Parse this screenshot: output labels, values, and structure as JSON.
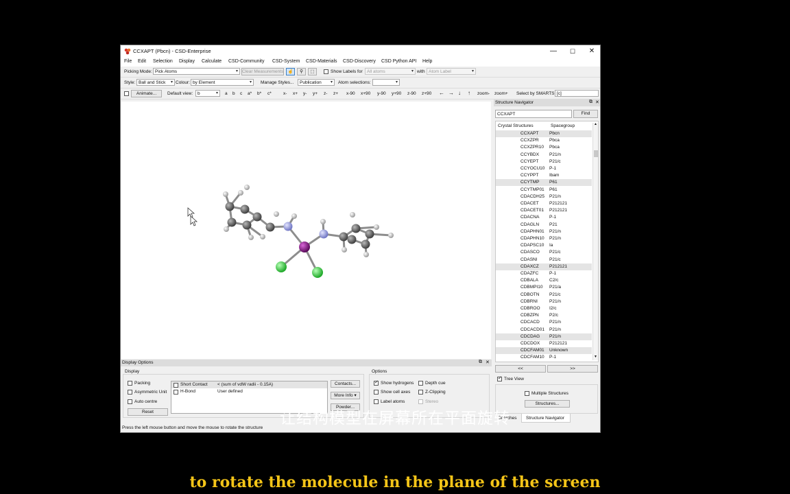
{
  "window": {
    "title": "CCXAPT (Pbcn) - CSD-Enterprise",
    "minimize": "—",
    "maximize": "☐",
    "close": "✕"
  },
  "menu": [
    "File",
    "Edit",
    "Selection",
    "Display",
    "Calculate",
    "CSD-Community",
    "CSD-System",
    "CSD-Materials",
    "CSD-Discovery",
    "CSD Python API",
    "Help"
  ],
  "toolbar1": {
    "picking_mode_label": "Picking Mode:",
    "picking_mode_value": "Pick Atoms",
    "clear_measurements": "Clear Measurements",
    "show_labels_for": "Show Labels for",
    "labels_value": "All atoms",
    "with_label": "with",
    "atom_label_value": "Atom Label"
  },
  "toolbar2": {
    "style_label": "Style:",
    "style_value": "Ball and Stick",
    "colour_label": "Colour:",
    "colour_value": "by Element",
    "manage_styles": "Manage Styles...",
    "manage_value": "Publication",
    "atom_selections_label": "Atom selections:",
    "atom_selections_value": ""
  },
  "toolbar3": {
    "animate": "Animate...",
    "default_view_label": "Default view:",
    "default_view_value": "b",
    "axes": [
      "a",
      "b",
      "c",
      "a*",
      "b*",
      "c*"
    ],
    "rot": [
      "x-",
      "x+",
      "y-",
      "y+",
      "z-",
      "z+",
      "x-90",
      "x+90",
      "y-90",
      "y+90",
      "z-90",
      "z+90"
    ],
    "arrows": [
      "←",
      "→",
      "↓",
      "↑"
    ],
    "zoom": [
      "zoom-",
      "zoom+"
    ],
    "smarts_label": "Select by SMARTS:",
    "smarts_value": "[c]"
  },
  "navigator": {
    "title": "Structure Navigator",
    "search_value": "CCXAPT",
    "find": "Find",
    "col1": "Crystal Structures",
    "col2": "Spacegroup",
    "rows": [
      [
        "CCXAPT",
        "Pbcn"
      ],
      [
        "CCXZPR",
        "Pbca"
      ],
      [
        "CCXZPR10",
        "Pbca"
      ],
      [
        "CCYBDX",
        "P21/n"
      ],
      [
        "CCYEPT",
        "P21/c"
      ],
      [
        "CCYOCU10",
        "P-1"
      ],
      [
        "CCYPPT",
        "Ibam"
      ],
      [
        "CCYTMP",
        "P61"
      ],
      [
        "CCYTMP01",
        "P61"
      ],
      [
        "CDACDH25",
        "P21/n"
      ],
      [
        "CDACET",
        "P212121"
      ],
      [
        "CDACET01",
        "P212121"
      ],
      [
        "CDACNA",
        "P-1"
      ],
      [
        "CDAGLN",
        "P21"
      ],
      [
        "CDAPHN01",
        "P21/n"
      ],
      [
        "CDAPHN10",
        "P21/n"
      ],
      [
        "CDAPSC10",
        "Ia"
      ],
      [
        "CDASCO",
        "P21/c"
      ],
      [
        "CDASNI",
        "P21/c"
      ],
      [
        "CDAXCZ",
        "P212121"
      ],
      [
        "CDAZFC",
        "P-1"
      ],
      [
        "CDBALA",
        "C2/c"
      ],
      [
        "CDBMPI10",
        "P21/a"
      ],
      [
        "CDBOTN",
        "P21/c"
      ],
      [
        "CDBRNI",
        "P21/n"
      ],
      [
        "CDBROO",
        "I2/c"
      ],
      [
        "CDBZPN",
        "P2/c"
      ],
      [
        "CDCACD",
        "P21/n"
      ],
      [
        "CDCACD01",
        "P21/n"
      ],
      [
        "CDCDAG",
        "P21/n"
      ],
      [
        "CDCDOX",
        "P212121"
      ],
      [
        "CDCFAM01",
        "Unknown"
      ],
      [
        "CDCFAM10",
        "P-1"
      ]
    ],
    "prev": "<<",
    "next": ">>",
    "tree_view": "Tree View",
    "multiple_structures": "Multiple Structures",
    "structures_btn": "Structures...",
    "tab_searches": "Searches",
    "tab_navigator": "Structure Navigator"
  },
  "display_options": {
    "title": "Display Options",
    "display_group": "Display",
    "packing": "Packing",
    "asymmetric_unit": "Asymmetric Unit",
    "auto_centre": "Auto centre",
    "reset": "Reset",
    "contacts": [
      {
        "name": "Short Contact",
        "desc": "< (sum of vdW radii - 0.15A)"
      },
      {
        "name": "H-Bond",
        "desc": "User defined"
      }
    ],
    "contacts_btn": "Contacts...",
    "more_info_btn": "More Info",
    "powder_btn": "Powder...",
    "options_group": "Options",
    "show_hydrogens": "Show hydrogens",
    "show_cell_axes": "Show cell axes",
    "label_atoms": "Label atoms",
    "depth_cue": "Depth cue",
    "z_clipping": "Z-Clipping",
    "stereo": "Stereo"
  },
  "status_text": "Press the left mouse button and move the mouse to rotate the structure",
  "subtitle_cn": "让结构模型在屏幕所在平面旋转",
  "subtitle_en": "to rotate the molecule in the plane of the screen",
  "colors": {
    "carbon": "#5f5f5f",
    "hydrogen": "#d9d9d9",
    "nitrogen": "#a4a8e8",
    "platinum": "#8a1a8a",
    "chlorine": "#3fd94a",
    "subtitle_en": "#f5c518"
  }
}
